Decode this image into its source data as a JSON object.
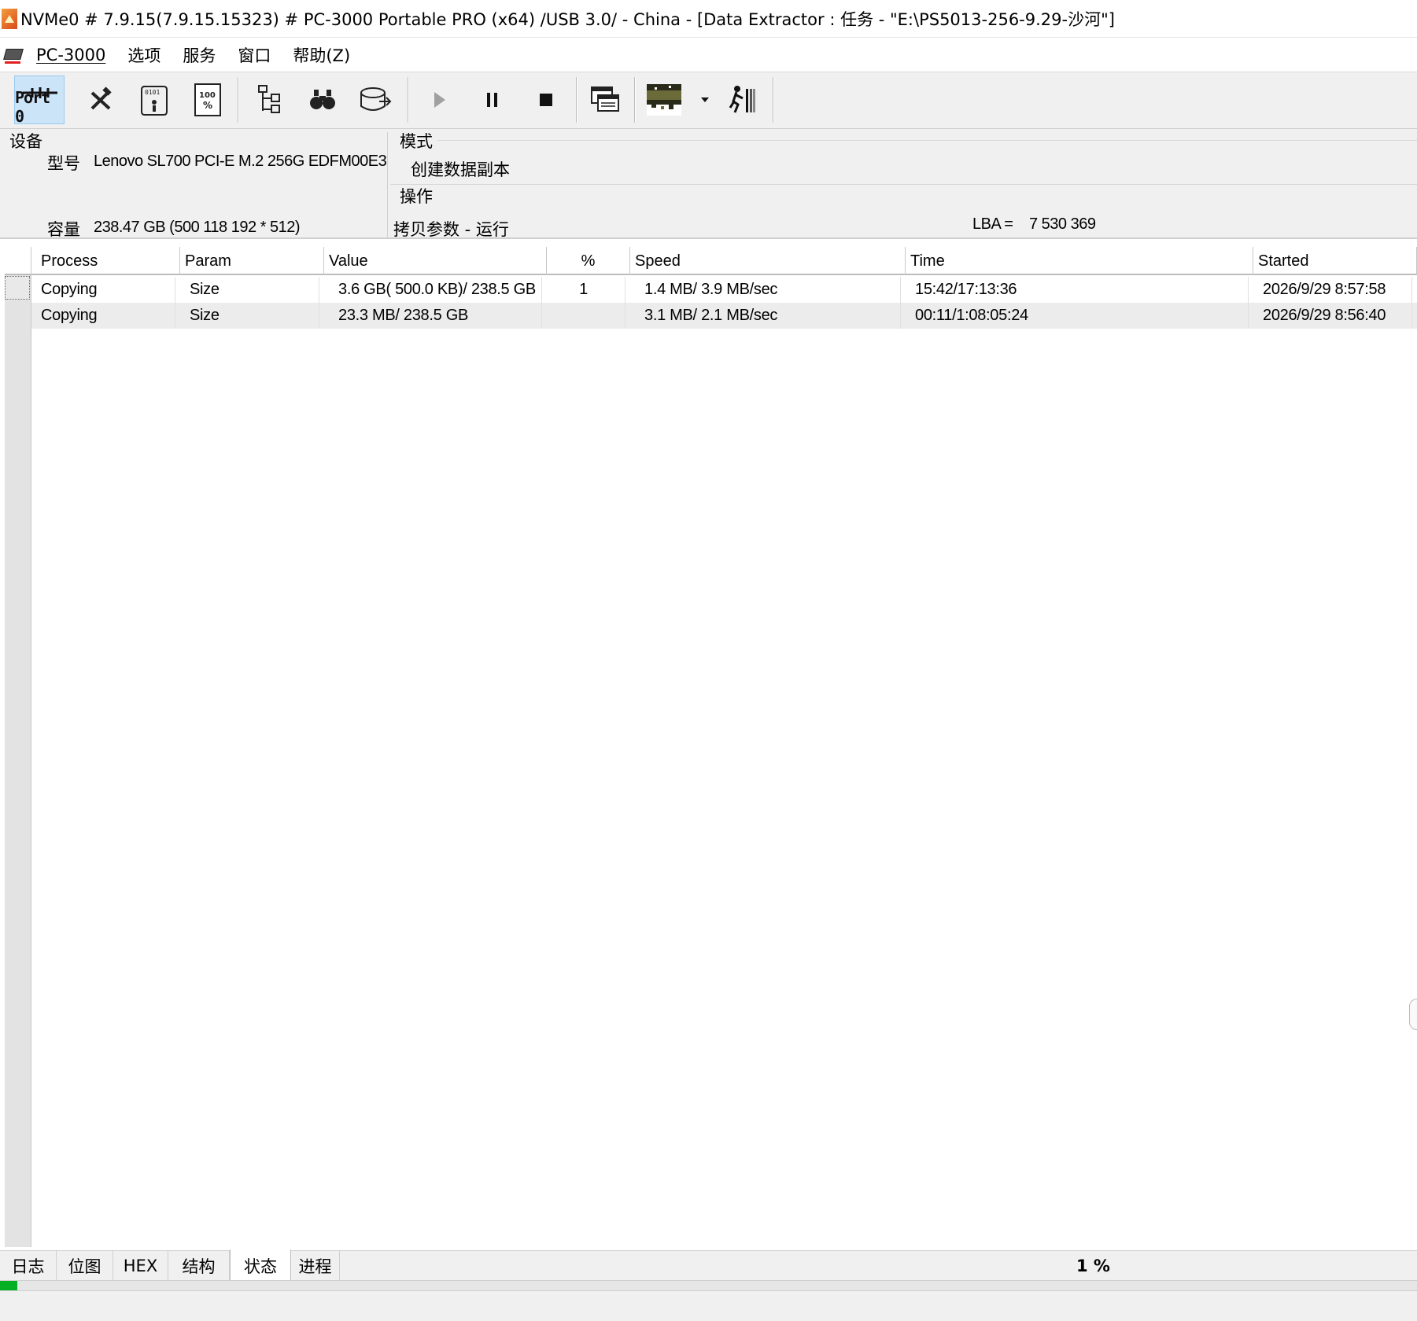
{
  "window": {
    "title": "NVMe0 # 7.9.15(7.9.15.15323) # PC-3000 Portable PRO (x64) /USB 3.0/ - China - [Data Extractor : 任务 - \"E:\\PS5013-256-9.29-沙河\"]"
  },
  "menu": {
    "items": [
      "PC-3000",
      "选项",
      "服务",
      "窗口",
      "帮助(Z)"
    ]
  },
  "toolbar": {
    "port_label": "Port 0",
    "icons": [
      "port-icon",
      "tools-icon",
      "firmware-scroll-icon",
      "percent-document-icon",
      "tree-structure-icon",
      "binoculars-icon",
      "disk-export-icon",
      "play-icon",
      "pause-icon",
      "stop-icon",
      "windows-icon",
      "bitmap-view-icon",
      "dropdown-arrow-icon",
      "exit-runner-icon"
    ]
  },
  "device": {
    "section_label": "设备",
    "model_label": "型号",
    "model_value": "Lenovo  SL700 PCI-E M.2 256G EDFM00E3",
    "capacity_label": "容量",
    "capacity_value": "238.47 GB (500 118 192 * 512)"
  },
  "mode": {
    "section_label": "模式",
    "value": "创建数据副本"
  },
  "operation": {
    "section_label": "操作",
    "value": "拷贝参数 - 运行",
    "lba_label": "LBA =",
    "lba_value": "7 530 369"
  },
  "table": {
    "columns": [
      "Process",
      "Param",
      "Value",
      "%",
      "Speed",
      "Time",
      "Started"
    ],
    "rows": [
      {
        "process": "Copying",
        "param": "Size",
        "value": "3.6 GB( 500.0 KB)/ 238.5 GB",
        "percent": "1",
        "speed": "1.4 MB/ 3.9 MB/sec",
        "time": "15:42/17:13:36",
        "started": "2026/9/29 8:57:58"
      },
      {
        "process": "Copying",
        "param": "Size",
        "value": "23.3 MB/ 238.5 GB",
        "percent": "",
        "speed": "3.1 MB/ 2.1 MB/sec",
        "time": "00:11/1:08:05:24",
        "started": "2026/9/29 8:56:40"
      }
    ]
  },
  "tabs": {
    "items": [
      "日志",
      "位图",
      "HEX",
      "结构",
      "状态",
      "进程"
    ],
    "active": "状态",
    "percent_text": "1 %"
  },
  "progress": {
    "fraction": 0.012
  },
  "colors": {
    "progress_green": "#06b025",
    "active_tool": "#cce4f7",
    "panel_bg": "#f0f0f0"
  }
}
